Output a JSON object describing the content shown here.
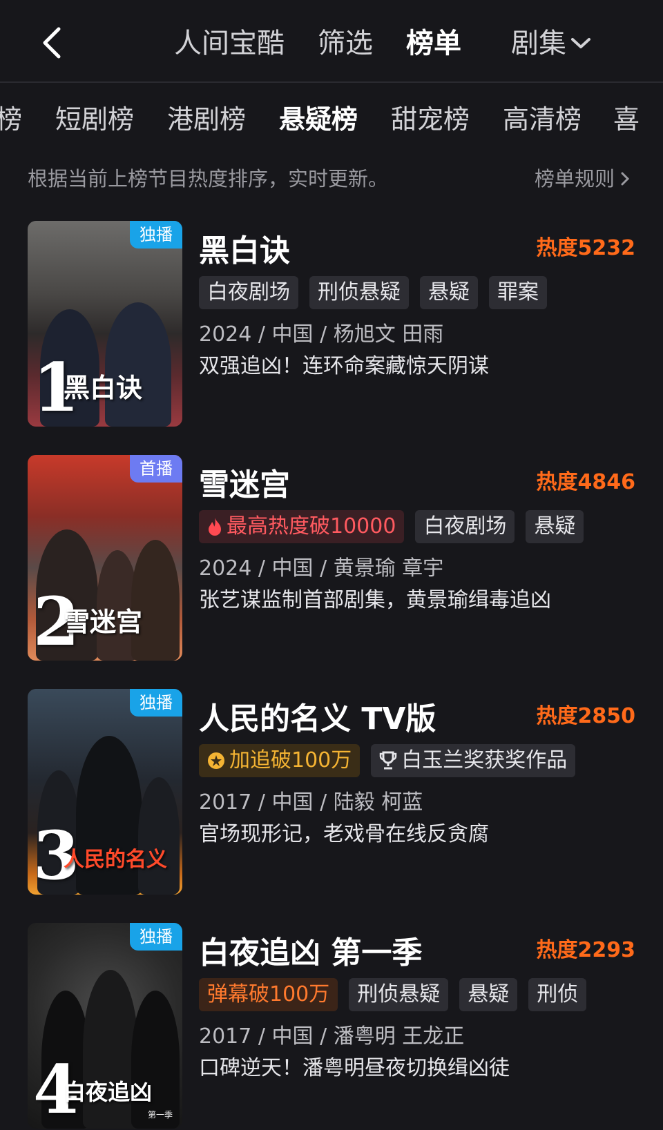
{
  "header": {
    "nav": [
      {
        "label": "人间宝酷"
      },
      {
        "label": "筛选"
      },
      {
        "label": "榜单"
      }
    ],
    "dropdown": "剧集"
  },
  "category_tabs": [
    "榜",
    "短剧榜",
    "港剧榜",
    "悬疑榜",
    "甜宠榜",
    "高清榜",
    "喜"
  ],
  "active_tab_index": 3,
  "info_text": "根据当前上榜节目热度排序，实时更新。",
  "rules_label": "榜单规则",
  "colors": {
    "background": "#17171b",
    "heat": "#ff6a1a",
    "badge_exclusive": "#19a3e8",
    "badge_premiere": "#6d7bf2"
  },
  "items": [
    {
      "rank": "1",
      "badge": "独播",
      "poster_title": "黑白诀",
      "title": "黑白诀",
      "heat": "热度5232",
      "tags": [
        "白夜剧场",
        "刑侦悬疑",
        "悬疑",
        "罪案"
      ],
      "meta": "2024 / 中国 / 杨旭文 田雨",
      "desc": "双强追凶！连环命案藏惊天阴谋"
    },
    {
      "rank": "2",
      "badge": "首播",
      "poster_title": "雪迷宫",
      "title": "雪迷宫",
      "heat": "热度4846",
      "highlight_tag": "最高热度破10000",
      "highlight_icon": "flame-icon",
      "tags": [
        "白夜剧场",
        "悬疑"
      ],
      "meta": "2024 / 中国 / 黄景瑜 章宇",
      "desc": "张艺谋监制首部剧集，黄景瑜缉毒追凶"
    },
    {
      "rank": "3",
      "badge": "独播",
      "poster_title": "人民的名义",
      "title": "人民的名义 TV版",
      "heat": "热度2850",
      "highlight_tag": "加追破100万",
      "highlight_icon": "star-badge-icon",
      "tags": [
        "白玉兰奖获奖作品"
      ],
      "tag_icon": "trophy-icon",
      "meta": "2017 / 中国 / 陆毅 柯蓝",
      "desc": "官场现形记，老戏骨在线反贪腐"
    },
    {
      "rank": "4",
      "badge": "独播",
      "poster_title": "白夜追凶",
      "poster_sub": "第一季",
      "title": "白夜追凶 第一季",
      "heat": "热度2293",
      "highlight_tag": "弹幕破100万",
      "tags": [
        "刑侦悬疑",
        "悬疑",
        "刑侦"
      ],
      "meta": "2017 / 中国 / 潘粤明 王龙正",
      "desc": "口碑逆天！潘粤明昼夜切换缉凶徒"
    }
  ]
}
